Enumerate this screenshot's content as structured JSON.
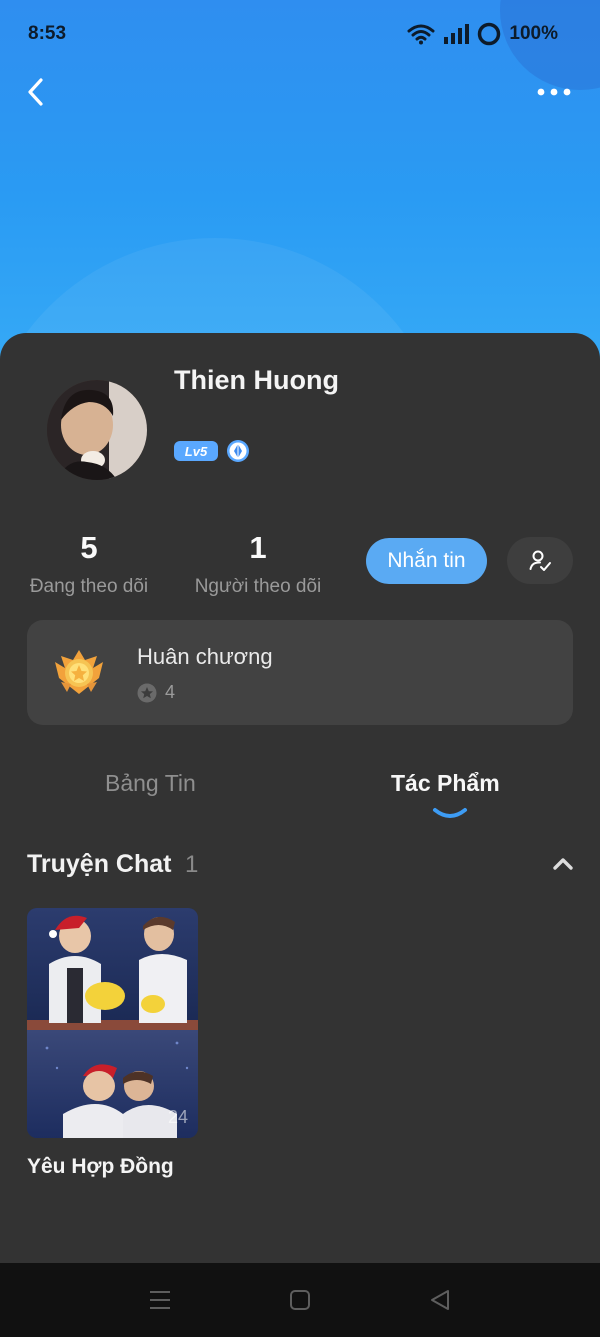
{
  "status_bar": {
    "time": "8:53",
    "battery": "100%"
  },
  "profile": {
    "name": "Thien Huong",
    "level": "Lv5",
    "following_count": "5",
    "following_label": "Đang theo dõi",
    "followers_count": "1",
    "followers_label": "Người theo dõi",
    "message_button": "Nhắn tin"
  },
  "medals": {
    "title": "Huân chương",
    "count": "4"
  },
  "tabs": [
    {
      "label": "Bảng Tin",
      "active": false
    },
    {
      "label": "Tác Phẩm",
      "active": true
    }
  ],
  "section": {
    "title": "Truyện Chat",
    "count": "1"
  },
  "stories": [
    {
      "title": "Yêu Hợp Đồng",
      "count": "24"
    }
  ],
  "colors": {
    "header_blue": "#2a9bf3",
    "accent_blue": "#5aaaf3",
    "sheet_bg": "#333333",
    "card_bg": "#424242"
  },
  "icons": {
    "back": "chevron-left-icon",
    "more": "more-dots-icon",
    "gem": "diamond-badge-icon",
    "follow": "user-check-icon",
    "medal": "medal-icon",
    "collapse": "chevron-up-icon"
  }
}
